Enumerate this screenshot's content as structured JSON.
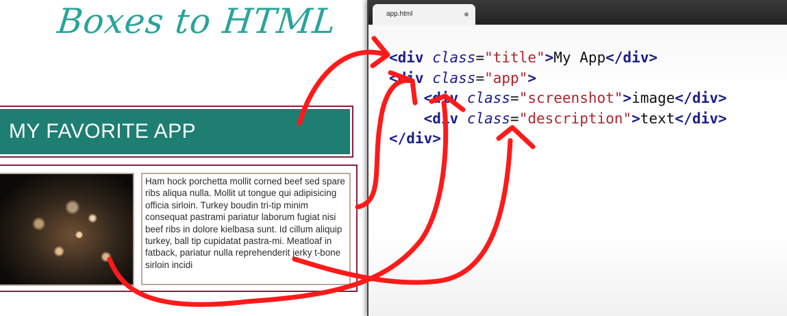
{
  "slide": {
    "handwritten_title": "Boxes to HTML",
    "mockup_title": "MY FAVORITE APP",
    "mockup_description": "Ham hock porchetta mollit corned beef sed spare ribs aliqua nulla. Mollit ut tongue qui adipisicing officia sirloin. Turkey boudin tri-tip minim consequat pastrami pariatur laborum fugiat nisi beef ribs in dolore kielbasa sunt. Id cillum aliquip turkey, ball tip cupidatat pastra-mi. Meatloaf in fatback, pariatur nulla reprehenderit jerky t-bone sirloin incidi"
  },
  "editor": {
    "tab_label": "app.html",
    "lines": [
      {
        "indent": "",
        "parts": [
          [
            "tag",
            "<div"
          ],
          [
            "txt",
            " "
          ],
          [
            "attr",
            "class"
          ],
          [
            "txt",
            "="
          ],
          [
            "str",
            "\"title\""
          ],
          [
            "tag",
            ">"
          ],
          [
            "txt",
            "My App"
          ],
          [
            "tag",
            "</div>"
          ]
        ]
      },
      {
        "indent": "",
        "parts": [
          [
            "tag",
            "<div"
          ],
          [
            "txt",
            " "
          ],
          [
            "attr",
            "class"
          ],
          [
            "txt",
            "="
          ],
          [
            "str",
            "\"app\""
          ],
          [
            "tag",
            ">"
          ]
        ]
      },
      {
        "indent": "    ",
        "parts": [
          [
            "tag",
            "<div"
          ],
          [
            "txt",
            " "
          ],
          [
            "attr",
            "class"
          ],
          [
            "txt",
            "="
          ],
          [
            "str",
            "\"screenshot\""
          ],
          [
            "tag",
            ">"
          ],
          [
            "txt",
            "image"
          ],
          [
            "tag",
            "</div>"
          ]
        ]
      },
      {
        "indent": "    ",
        "parts": [
          [
            "tag",
            "<div"
          ],
          [
            "txt",
            " "
          ],
          [
            "attr",
            "class"
          ],
          [
            "txt",
            "="
          ],
          [
            "str",
            "\"description\""
          ],
          [
            "tag",
            ">"
          ],
          [
            "txt",
            "text"
          ],
          [
            "tag",
            "</div>"
          ]
        ]
      },
      {
        "indent": "",
        "parts": [
          [
            "tag",
            "</div>"
          ]
        ]
      }
    ]
  },
  "colors": {
    "teal_title": "#2aa49a",
    "mockup_header_bg": "#1e7e72",
    "mockup_border": "#8a1d3c",
    "arrow_red": "#ff1a1a",
    "code_tag": "#1a1d8c",
    "code_string": "#b0252c"
  }
}
